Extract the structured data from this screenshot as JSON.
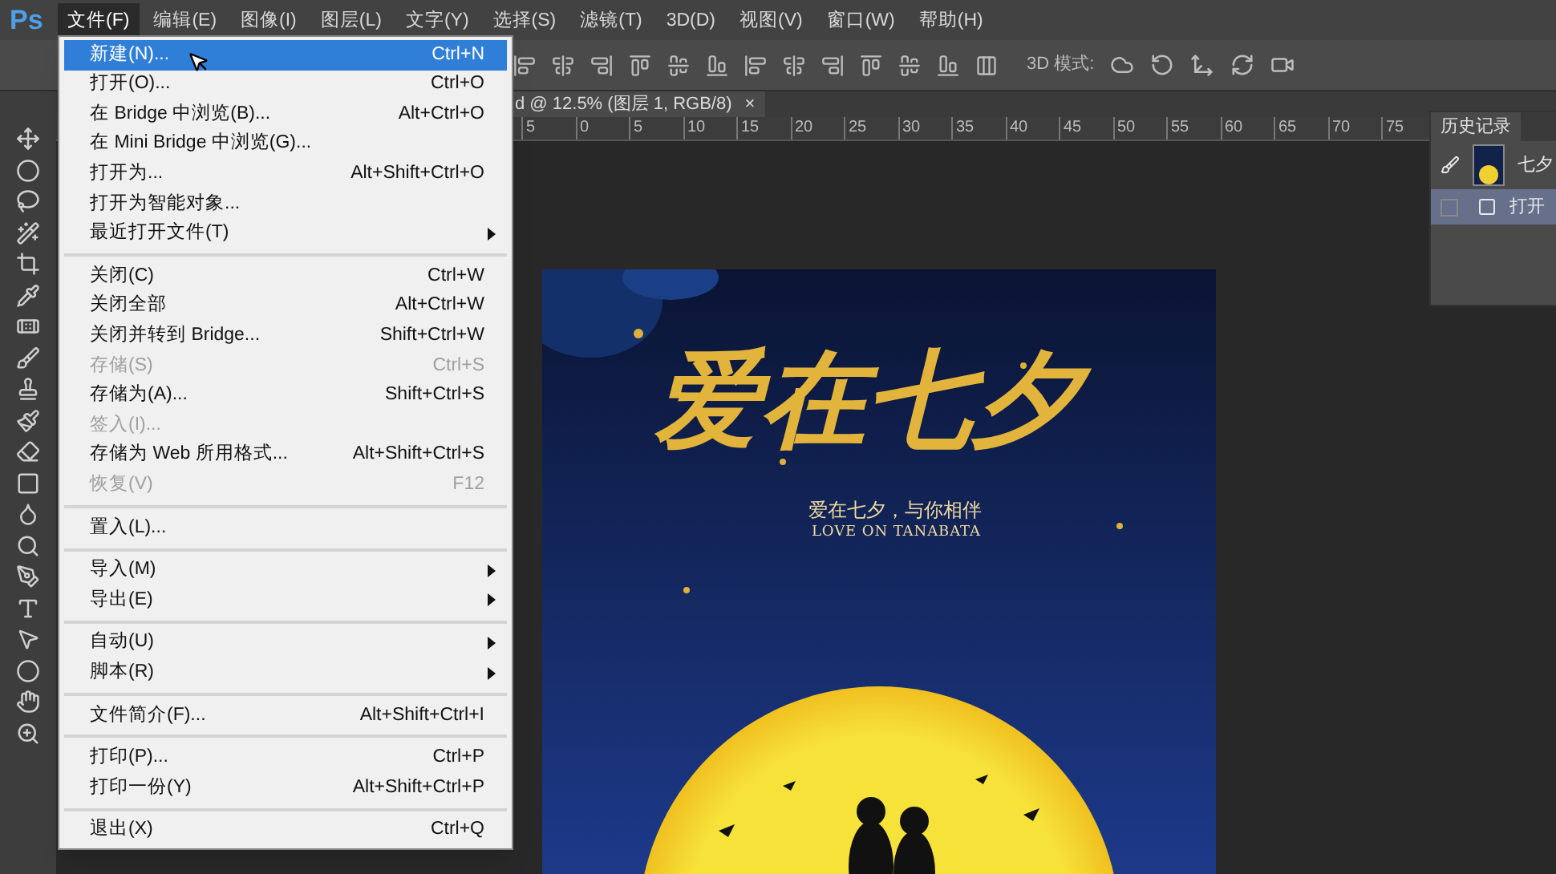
{
  "app_logo": "Ps",
  "menu_bar": [
    {
      "label": "文件(F)",
      "selected": true
    },
    {
      "label": "编辑(E)",
      "selected": false
    },
    {
      "label": "图像(I)",
      "selected": false
    },
    {
      "label": "图层(L)",
      "selected": false
    },
    {
      "label": "文字(Y)",
      "selected": false
    },
    {
      "label": "选择(S)",
      "selected": false
    },
    {
      "label": "滤镜(T)",
      "selected": false
    },
    {
      "label": "3D(D)",
      "selected": false
    },
    {
      "label": "视图(V)",
      "selected": false
    },
    {
      "label": "窗口(W)",
      "selected": false
    },
    {
      "label": "帮助(H)",
      "selected": false
    }
  ],
  "options_bar": {
    "mode_label": "3D 模式:"
  },
  "document_tab": {
    "title": "d @ 12.5% (图层 1, RGB/8)",
    "close": "×"
  },
  "ruler": [
    "5",
    "0",
    "5",
    "10",
    "15",
    "20",
    "25",
    "30",
    "35",
    "40",
    "45",
    "50",
    "55",
    "60",
    "65",
    "70",
    "75"
  ],
  "file_menu": [
    [
      {
        "label": "新建(N)...",
        "shortcut": "Ctrl+N",
        "selected": true,
        "disabled": false,
        "submenu": false
      },
      {
        "label": "打开(O)...",
        "shortcut": "Ctrl+O",
        "selected": false,
        "disabled": false,
        "submenu": false
      },
      {
        "label": "在 Bridge 中浏览(B)...",
        "shortcut": "Alt+Ctrl+O",
        "selected": false,
        "disabled": false,
        "submenu": false
      },
      {
        "label": "在 Mini Bridge 中浏览(G)...",
        "selected": false,
        "disabled": false,
        "submenu": false
      },
      {
        "label": "打开为...",
        "shortcut": "Alt+Shift+Ctrl+O",
        "selected": false,
        "disabled": false,
        "submenu": false
      },
      {
        "label": "打开为智能对象...",
        "selected": false,
        "disabled": false,
        "submenu": false
      },
      {
        "label": "最近打开文件(T)",
        "selected": false,
        "disabled": false,
        "submenu": true
      }
    ],
    [
      {
        "label": "关闭(C)",
        "shortcut": "Ctrl+W",
        "selected": false,
        "disabled": false,
        "submenu": false
      },
      {
        "label": "关闭全部",
        "shortcut": "Alt+Ctrl+W",
        "selected": false,
        "disabled": false,
        "submenu": false
      },
      {
        "label": "关闭并转到 Bridge...",
        "shortcut": "Shift+Ctrl+W",
        "selected": false,
        "disabled": false,
        "submenu": false
      },
      {
        "label": "存储(S)",
        "shortcut": "Ctrl+S",
        "selected": false,
        "disabled": true,
        "submenu": false
      },
      {
        "label": "存储为(A)...",
        "shortcut": "Shift+Ctrl+S",
        "selected": false,
        "disabled": false,
        "submenu": false
      },
      {
        "label": "签入(I)...",
        "selected": false,
        "disabled": true,
        "submenu": false
      },
      {
        "label": "存储为 Web 所用格式...",
        "shortcut": "Alt+Shift+Ctrl+S",
        "selected": false,
        "disabled": false,
        "submenu": false
      },
      {
        "label": "恢复(V)",
        "shortcut": "F12",
        "selected": false,
        "disabled": true,
        "submenu": false
      }
    ],
    [
      {
        "label": "置入(L)...",
        "selected": false,
        "disabled": false,
        "submenu": false
      }
    ],
    [
      {
        "label": "导入(M)",
        "selected": false,
        "disabled": false,
        "submenu": true
      },
      {
        "label": "导出(E)",
        "selected": false,
        "disabled": false,
        "submenu": true
      }
    ],
    [
      {
        "label": "自动(U)",
        "selected": false,
        "disabled": false,
        "submenu": true
      },
      {
        "label": "脚本(R)",
        "selected": false,
        "disabled": false,
        "submenu": true
      }
    ],
    [
      {
        "label": "文件简介(F)...",
        "shortcut": "Alt+Shift+Ctrl+I",
        "selected": false,
        "disabled": false,
        "submenu": false
      }
    ],
    [
      {
        "label": "打印(P)...",
        "shortcut": "Ctrl+P",
        "selected": false,
        "disabled": false,
        "submenu": false
      },
      {
        "label": "打印一份(Y)",
        "shortcut": "Alt+Shift+Ctrl+P",
        "selected": false,
        "disabled": false,
        "submenu": false
      }
    ],
    [
      {
        "label": "退出(X)",
        "shortcut": "Ctrl+Q",
        "selected": false,
        "disabled": false,
        "submenu": false
      }
    ]
  ],
  "history_panel": {
    "title": "历史记录",
    "items": [
      {
        "kind": "snapshot",
        "label": "七夕",
        "selected": false
      },
      {
        "kind": "step",
        "label": "打开",
        "selected": true
      }
    ]
  },
  "poster": {
    "title": "爱在七夕",
    "subtitle": "爱在七夕，与你相伴",
    "english": "LOVE ON TANABATA"
  }
}
